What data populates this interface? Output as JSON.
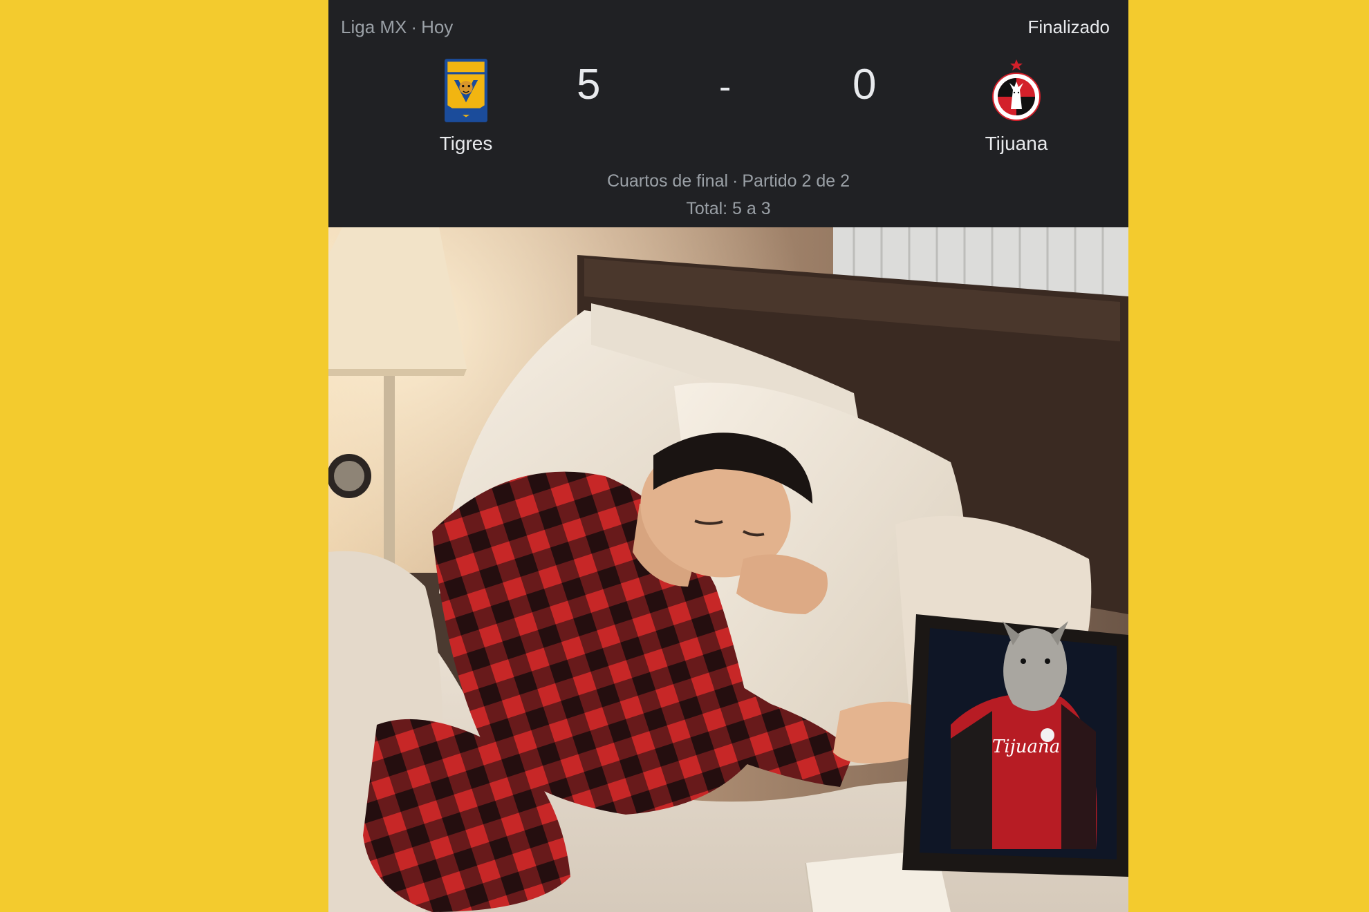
{
  "colors": {
    "background": "#F3CB2E",
    "card": "#202124",
    "muted_text": "#9aa0a6",
    "primary_text": "#e8eaed",
    "tigres_gold": "#F2B511",
    "tigres_blue": "#1B4C9B",
    "tijuana_red": "#D3202A",
    "tijuana_black": "#111111"
  },
  "scorecard": {
    "league": "Liga MX",
    "date": "Hoy",
    "status": "Finalizado",
    "home": {
      "name": "Tigres",
      "score": "5",
      "logo_icon": "tigres-uanl-crest-icon"
    },
    "away": {
      "name": "Tijuana",
      "score": "0",
      "logo_icon": "club-tijuana-crest-icon"
    },
    "separator": "-",
    "round": "Cuartos de final",
    "leg": "Partido 2 de 2",
    "aggregate": "Total: 5 a 3"
  },
  "photo": {
    "framed_photo_text": "Tijuana"
  }
}
